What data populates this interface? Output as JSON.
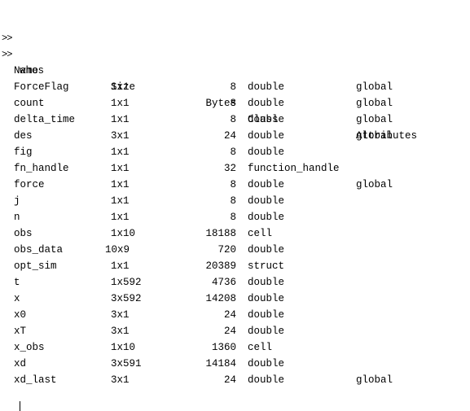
{
  "console": {
    "prompt": ">>",
    "lines": [
      {
        "prompt": ">>",
        "command": ""
      },
      {
        "prompt": ">>",
        "command": "whos"
      }
    ]
  },
  "whos_table": {
    "headers": {
      "name": "Name",
      "size": "Size",
      "bytes": "Bytes",
      "class": "Class",
      "attributes": "Attributes"
    },
    "rows": [
      {
        "name": "ForceFlag",
        "size": "1x1",
        "bytes": "8",
        "class": "double",
        "attributes": "global"
      },
      {
        "name": "count",
        "size": "1x1",
        "bytes": "8",
        "class": "double",
        "attributes": "global"
      },
      {
        "name": "delta_time",
        "size": "1x1",
        "bytes": "8",
        "class": "double",
        "attributes": "global"
      },
      {
        "name": "des",
        "size": "3x1",
        "bytes": "24",
        "class": "double",
        "attributes": "global"
      },
      {
        "name": "fig",
        "size": "1x1",
        "bytes": "8",
        "class": "double",
        "attributes": ""
      },
      {
        "name": "fn_handle",
        "size": "1x1",
        "bytes": "32",
        "class": "function_handle",
        "attributes": ""
      },
      {
        "name": "force",
        "size": "1x1",
        "bytes": "8",
        "class": "double",
        "attributes": "global"
      },
      {
        "name": "j",
        "size": "1x1",
        "bytes": "8",
        "class": "double",
        "attributes": ""
      },
      {
        "name": "n",
        "size": "1x1",
        "bytes": "8",
        "class": "double",
        "attributes": ""
      },
      {
        "name": "obs",
        "size": "1x10",
        "bytes": "18188",
        "class": "cell",
        "attributes": ""
      },
      {
        "name": "obs_data",
        "size": "10x9",
        "bytes": "720",
        "class": "double",
        "attributes": ""
      },
      {
        "name": "opt_sim",
        "size": "1x1",
        "bytes": "20389",
        "class": "struct",
        "attributes": ""
      },
      {
        "name": "t",
        "size": "1x592",
        "bytes": "4736",
        "class": "double",
        "attributes": ""
      },
      {
        "name": "x",
        "size": "3x592",
        "bytes": "14208",
        "class": "double",
        "attributes": ""
      },
      {
        "name": "x0",
        "size": "3x1",
        "bytes": "24",
        "class": "double",
        "attributes": ""
      },
      {
        "name": "xT",
        "size": "3x1",
        "bytes": "24",
        "class": "double",
        "attributes": ""
      },
      {
        "name": "x_obs",
        "size": "1x10",
        "bytes": "1360",
        "class": "cell",
        "attributes": ""
      },
      {
        "name": "xd",
        "size": "3x591",
        "bytes": "14184",
        "class": "double",
        "attributes": ""
      },
      {
        "name": "xd_last",
        "size": "3x1",
        "bytes": "24",
        "class": "double",
        "attributes": "global"
      }
    ]
  }
}
